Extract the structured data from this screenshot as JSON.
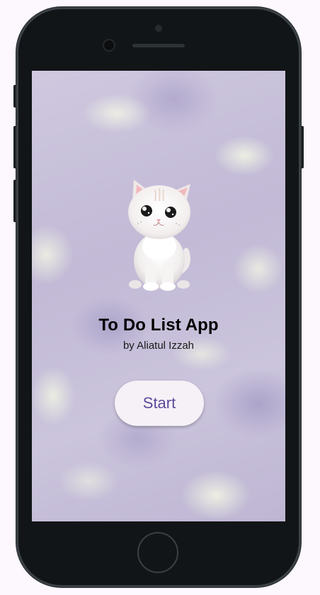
{
  "app": {
    "title": "To Do List App",
    "subtitle": "by Aliatul Izzah",
    "start_label": "Start"
  },
  "colors": {
    "button_bg": "#f5f1f7",
    "button_text": "#5b4a9b",
    "phone_body": "#121517",
    "background_lilac": "#c7c0d8"
  }
}
